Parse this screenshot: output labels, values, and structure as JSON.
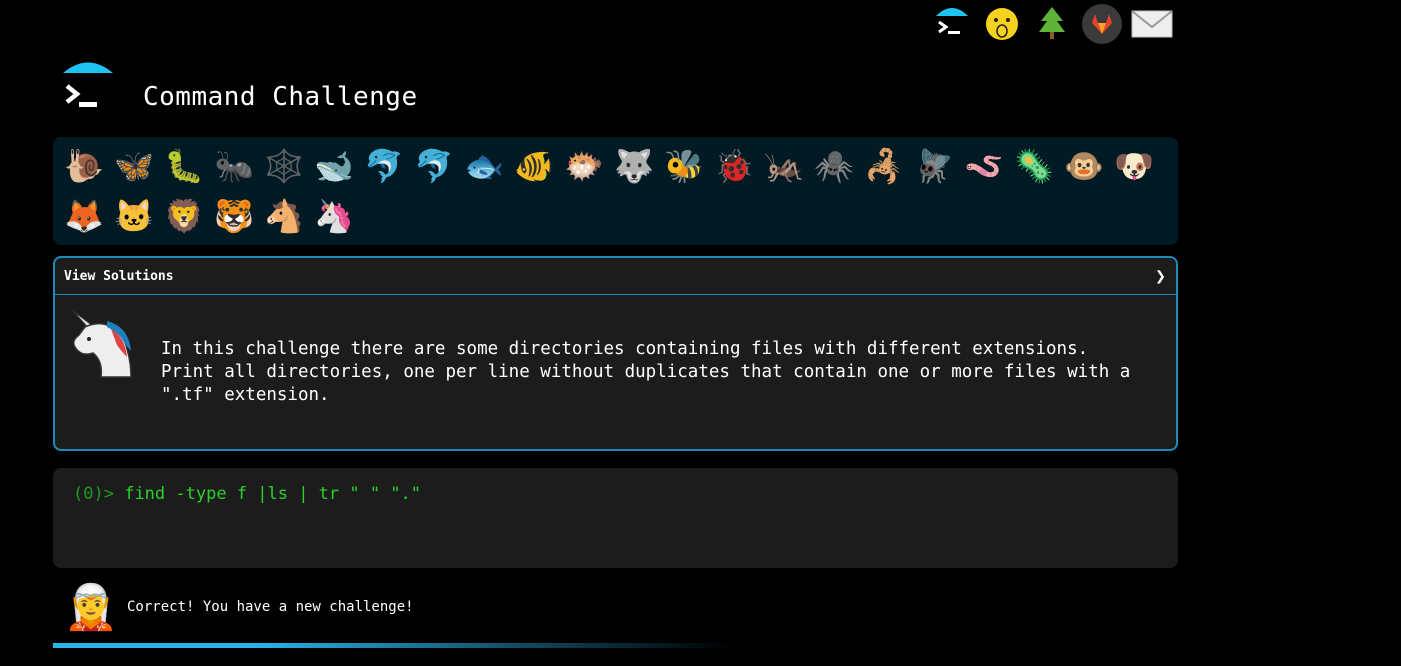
{
  "site": {
    "title": "Command Challenge"
  },
  "nav": {
    "items": [
      {
        "name": "home-logo-icon"
      },
      {
        "name": "hushed-face-icon",
        "glyph": "🫢"
      },
      {
        "name": "tree-icon"
      },
      {
        "name": "gitlab-icon"
      },
      {
        "name": "mail-icon"
      }
    ]
  },
  "animals": [
    "🐌",
    "🦋",
    "🐛",
    "🐜",
    "🕸️",
    "🐋",
    "🐬",
    "🐬",
    "🐟",
    "🐠",
    "🐡",
    "🐺",
    "🐝",
    "🐞",
    "🦗",
    "🕷️",
    "🦂",
    "🪰",
    "🪱",
    "🦠",
    "🐵",
    "🐶",
    "🦊",
    "🐱",
    "🦁",
    "🐯",
    "🐴",
    "🦄"
  ],
  "challenge": {
    "view_solutions_label": "View Solutions",
    "chevron": "❯",
    "description": "In this challenge there are some directories containing files with different extensions.\nPrint all directories, one per line without duplicates that contain one or more files with a\n\".tf\" extension."
  },
  "terminal": {
    "prompt": "(0)>",
    "command": "find -type f |ls | tr \" \" \".\""
  },
  "feedback": {
    "avatar": "🧝",
    "message": "Correct! You have a new challenge!"
  },
  "progress": {
    "value": 0.48
  },
  "colors": {
    "accent": "#1e8ab8",
    "terminal_text": "#2bd12b",
    "panel_bg": "#021a24"
  }
}
